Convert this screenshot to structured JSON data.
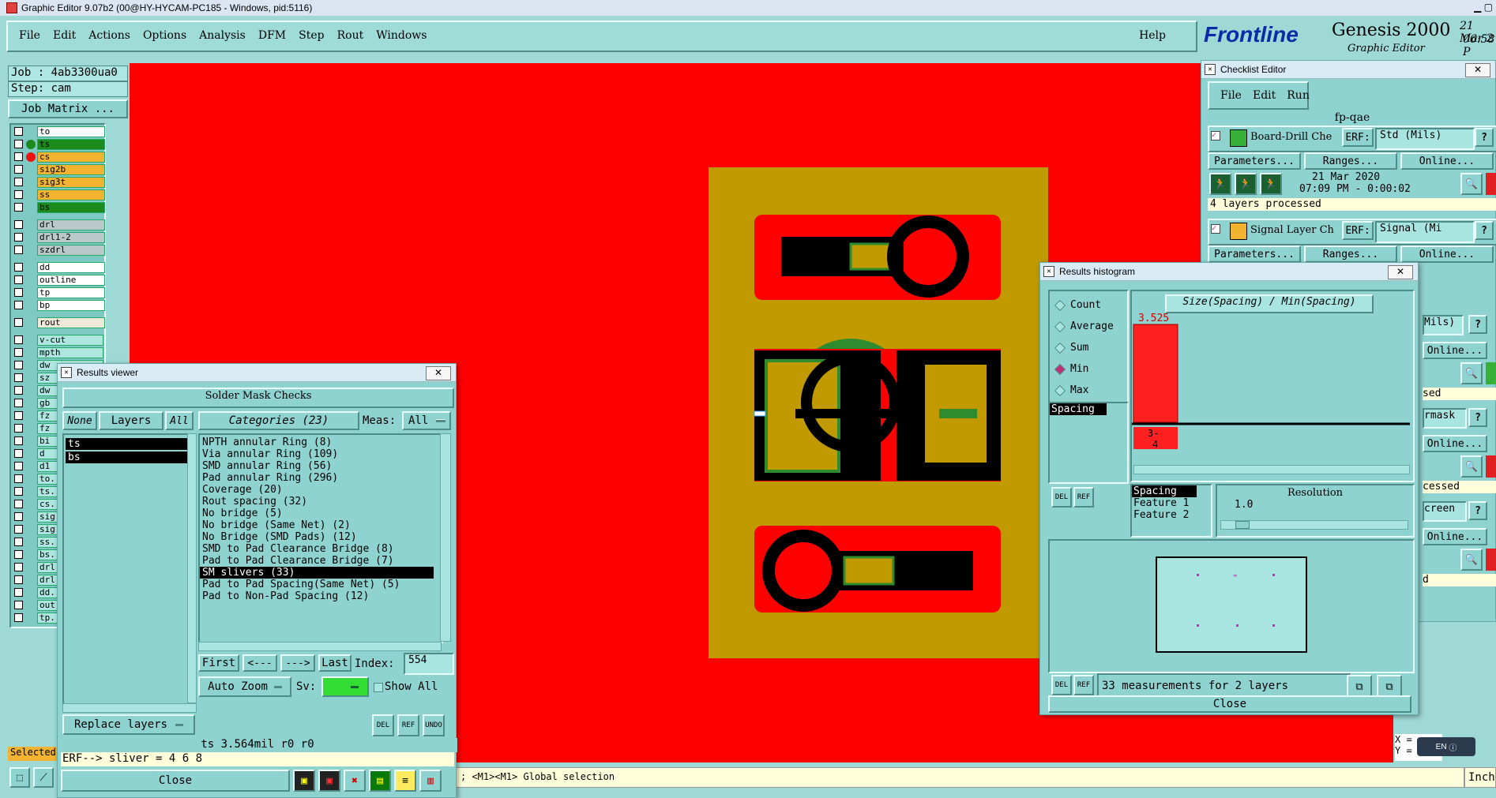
{
  "window": {
    "title": "Graphic Editor 9.07b2 (00@HY-HYCAM-PC185 - Windows, pid:5116)"
  },
  "menu": {
    "items": [
      "File",
      "Edit",
      "Actions",
      "Options",
      "Analysis",
      "DFM",
      "Step",
      "Rout",
      "Windows"
    ],
    "help": "Help"
  },
  "brand": {
    "logo": "Frontline",
    "product": "Genesis 2000",
    "subtitle": "Graphic Editor",
    "date": "21 Mar 2",
    "time": "06:58 P"
  },
  "job": {
    "job_label": "Job : 4ab3300ua0",
    "step_label": "Step: cam",
    "matrix_button": "Job Matrix ..."
  },
  "layers": {
    "board": [
      {
        "name": "to",
        "color": "#ffffff"
      },
      {
        "name": "ts",
        "color": "#1c8a1c"
      },
      {
        "name": "cs",
        "color": "#f2b331"
      },
      {
        "name": "sig2b",
        "color": "#f2b331"
      },
      {
        "name": "sig3t",
        "color": "#f2b331"
      },
      {
        "name": "ss",
        "color": "#f2b331"
      },
      {
        "name": "bs",
        "color": "#1c8a1c"
      }
    ],
    "drill": [
      "drl",
      "drl1-2",
      "szdrl"
    ],
    "misc": [
      "dd",
      "outline",
      "tp",
      "bp"
    ],
    "rout": [
      "rout"
    ],
    "other": [
      "v-cut",
      "mpth",
      "dw",
      "sz",
      "dw",
      "gb",
      "fz",
      "fz",
      "bi",
      "d",
      "d1",
      "to.",
      "ts.",
      "cs.",
      "sig",
      "sig",
      "ss.",
      "bs.",
      "drl",
      "drl",
      "dd.",
      "out",
      "tp."
    ]
  },
  "results_viewer": {
    "title": "Results viewer",
    "header": "Solder Mask Checks",
    "none_btn": "None",
    "layers_btn": "Layers",
    "all_btn": "All",
    "categories_btn": "Categories (23)",
    "meas_label": "Meas:",
    "meas_value": "All",
    "layer_list": [
      "ts",
      "bs"
    ],
    "categories": [
      "NPTH annular Ring (8)",
      "Via annular Ring (109)",
      "SMD annular Ring (56)",
      "Pad annular Ring (296)",
      "Coverage (20)",
      "Rout spacing (32)",
      "No bridge (5)",
      "No bridge (Same Net) (2)",
      "No Bridge (SMD Pads) (12)",
      "SMD to Pad Clearance Bridge (8)",
      "Pad to Pad Clearance Bridge (7)",
      "SM slivers (33)",
      "Pad to Pad Spacing(Same Net) (5)",
      "Pad to Non-Pad Spacing (12)"
    ],
    "selected_category": "SM slivers (33)",
    "nav": {
      "first": "First",
      "prev": "<---",
      "next": "--->",
      "last": "Last",
      "index_label": "Index:",
      "index_value": "554"
    },
    "auto_zoom": "Auto Zoom",
    "sv_label": "Sv:",
    "show_all": "Show All",
    "replace_layers": "Replace layers",
    "status": "ts 3.564mil  r0  r0",
    "erf": "ERF--> sliver = 4 6 8",
    "close": "Close"
  },
  "histogram": {
    "title": "Results histogram",
    "modes": [
      "Count",
      "Average",
      "Sum",
      "Min",
      "Max"
    ],
    "selected_mode": "Min",
    "chart_title": "Size(Spacing) / Min(Spacing)",
    "bar_value_label": "3.525",
    "bin_label_top": "3-",
    "bin_label_bottom": "4",
    "attr_list": [
      "Spacing"
    ],
    "feature_list": [
      "Spacing",
      "Feature 1",
      "Feature 2"
    ],
    "resolution_label": "Resolution",
    "resolution_value": "1.0",
    "summary": "33 measurements for 2 layers",
    "close": "Close"
  },
  "checklist": {
    "title": "Checklist Editor",
    "menu": [
      "File",
      "Edit",
      "Run"
    ],
    "name": "fp-qae",
    "action1": {
      "label": "Board-Drill Che",
      "erf": "ERF:",
      "erf_value": "Std (Mils)",
      "parameters": "Parameters...",
      "ranges": "Ranges...",
      "online": "Online...",
      "date": "21 Mar 2020",
      "time": "07:09 PM - 0:00:02",
      "status": "4 layers processed"
    },
    "action2": {
      "label": "Signal Layer Ch",
      "erf": "ERF:",
      "erf_value": "Signal (Mi",
      "parameters": "Parameters...",
      "ranges": "Ranges...",
      "online": "Online..."
    },
    "partial": [
      "Mils)",
      "Online...",
      "sed",
      "rmask",
      "Online...",
      "cessed",
      "creen",
      "Online...",
      "d"
    ]
  },
  "statusbar": {
    "hint": "; <M1><M1> Global selection",
    "selected": "Selected",
    "coords_x": "X =",
    "coords_y": "Y =",
    "units": "Inch",
    "lang": "EN"
  }
}
